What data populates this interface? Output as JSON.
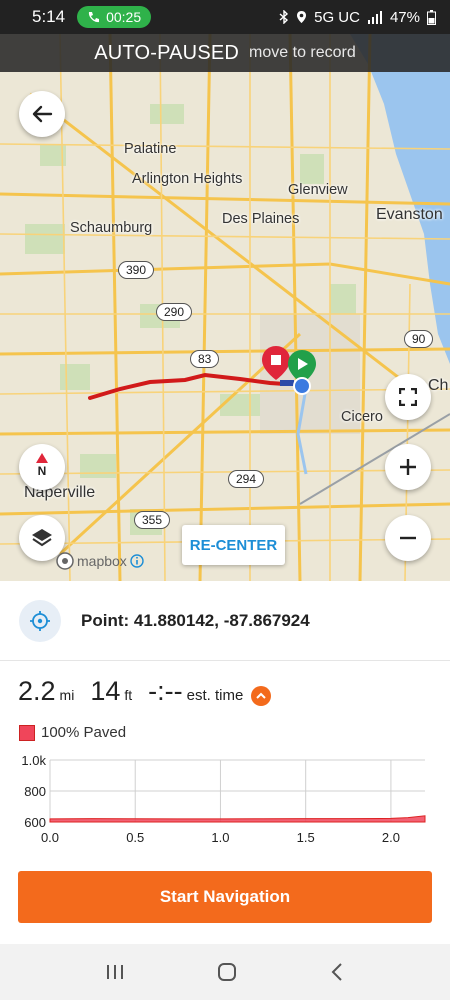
{
  "status_bar": {
    "time": "5:14",
    "call_duration": "00:25",
    "network": "5G UC",
    "battery": "47%"
  },
  "banner": {
    "title": "AUTO-PAUSED",
    "subtitle": "move to record"
  },
  "map": {
    "labels": {
      "palatine": "Palatine",
      "arlington_heights": "Arlington Heights",
      "glenview": "Glenview",
      "schaumburg": "Schaumburg",
      "des_plaines": "Des Plaines",
      "evanston": "Evanston",
      "cicero": "Cicero",
      "naperville": "Naperville",
      "chicago_partial": "Ch"
    },
    "shields": {
      "r390": "390",
      "r290": "290",
      "r83": "83",
      "r90": "90",
      "r294": "294",
      "r355": "355"
    },
    "recenter_label": "RE-CENTER",
    "attribution": "mapbox",
    "compass_letter": "N"
  },
  "point": {
    "label": "Point:",
    "coords": "41.880142, -87.867924"
  },
  "stats": {
    "distance": "2.2",
    "distance_unit": "mi",
    "elevation": "14",
    "elevation_unit": "ft",
    "time": "-:--",
    "time_label": "est. time"
  },
  "legend": {
    "label": "100% Paved",
    "color": "#f0455a"
  },
  "chart_data": {
    "type": "area",
    "title": "",
    "xlabel": "",
    "ylabel": "",
    "x": [
      0.0,
      0.25,
      0.5,
      0.75,
      1.0,
      1.25,
      1.5,
      1.75,
      2.0,
      2.1,
      2.2
    ],
    "series": [
      {
        "name": "",
        "values": [
          620,
          622,
          621,
          620,
          620,
          621,
          622,
          622,
          623,
          628,
          640
        ]
      }
    ],
    "xticks": [
      "0.0",
      "0.5",
      "1.0",
      "1.5",
      "2.0"
    ],
    "yticks": [
      "600",
      "800",
      "1.0k"
    ],
    "xlim": [
      0,
      2.2
    ],
    "ylim": [
      600,
      1000
    ],
    "grid": true,
    "color": "#f0455a"
  },
  "start_button": {
    "label": "Start Navigation",
    "color": "#f36a1c"
  }
}
